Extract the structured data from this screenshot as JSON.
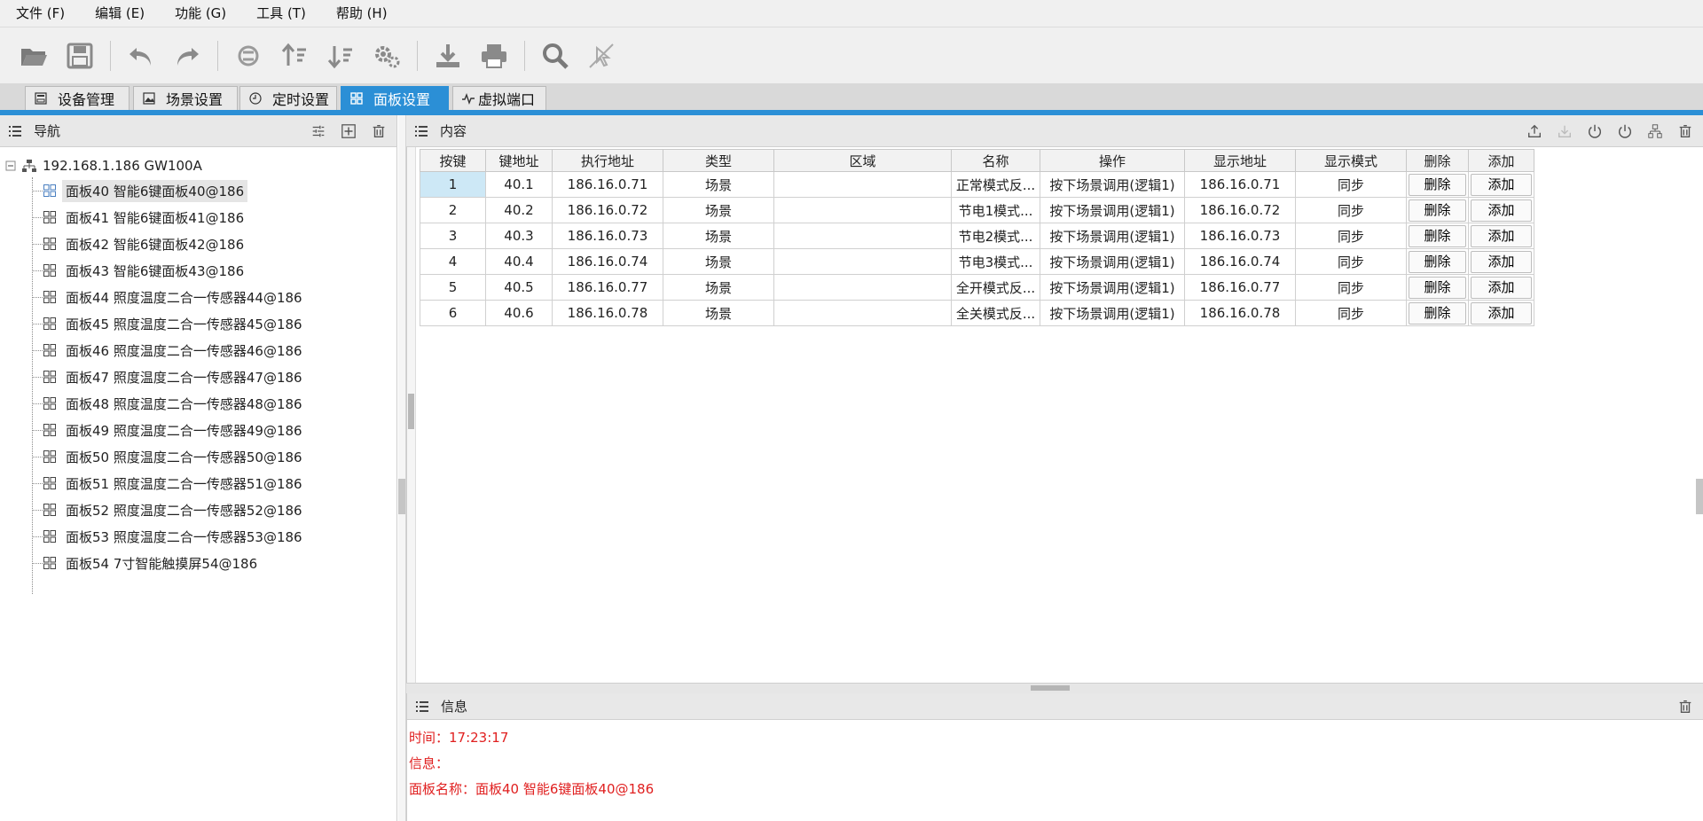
{
  "menu": [
    {
      "label": "文件 (F)"
    },
    {
      "label": "编辑 (E)"
    },
    {
      "label": "功能 (G)"
    },
    {
      "label": "工具 (T)"
    },
    {
      "label": "帮助 (H)"
    }
  ],
  "toolbar": {
    "buttons": [
      "open-folder-icon",
      "save-icon",
      "undo-icon",
      "redo-icon",
      "sync-icon",
      "sort-ascending-icon",
      "sort-descending-icon",
      "settings-icon",
      "download-icon",
      "print-icon",
      "search-icon",
      "disabled-pointer-icon"
    ]
  },
  "tabs": [
    {
      "label": "设备管理",
      "icon": "device-icon",
      "active": false
    },
    {
      "label": "场景设置",
      "icon": "image-icon",
      "active": false
    },
    {
      "label": "定时设置",
      "icon": "clock-icon",
      "active": false
    },
    {
      "label": "面板设置",
      "icon": "panel-grid-icon",
      "active": true
    },
    {
      "label": "虚拟端口",
      "icon": "pulse-icon",
      "active": false
    }
  ],
  "nav": {
    "title": "导航",
    "root": "192.168.1.186 GW100A",
    "items": [
      "面板40 智能6键面板40@186",
      "面板41 智能6键面板41@186",
      "面板42 智能6键面板42@186",
      "面板43 智能6键面板43@186",
      "面板44 照度温度二合一传感器44@186",
      "面板45 照度温度二合一传感器45@186",
      "面板46 照度温度二合一传感器46@186",
      "面板47 照度温度二合一传感器47@186",
      "面板48 照度温度二合一传感器48@186",
      "面板49 照度温度二合一传感器49@186",
      "面板50 照度温度二合一传感器50@186",
      "面板51 照度温度二合一传感器51@186",
      "面板52 照度温度二合一传感器52@186",
      "面板53 照度温度二合一传感器53@186",
      "面板54 7寸智能触摸屏54@186"
    ],
    "selected_index": 0
  },
  "content": {
    "title": "内容",
    "columns": [
      "按键",
      "键地址",
      "执行地址",
      "类型",
      "区域",
      "名称",
      "操作",
      "显示地址",
      "显示模式",
      "删除",
      "添加"
    ],
    "rows": [
      {
        "key": "1",
        "key_addr": "40.1",
        "exec_addr": "186.16.0.71",
        "type": "场景",
        "area": "",
        "name": "正常模式反...",
        "op": "按下场景调用(逻辑1)",
        "disp_addr": "186.16.0.71",
        "disp_mode": "同步",
        "del": "删除",
        "add": "添加"
      },
      {
        "key": "2",
        "key_addr": "40.2",
        "exec_addr": "186.16.0.72",
        "type": "场景",
        "area": "",
        "name": "节电1模式...",
        "op": "按下场景调用(逻辑1)",
        "disp_addr": "186.16.0.72",
        "disp_mode": "同步",
        "del": "删除",
        "add": "添加"
      },
      {
        "key": "3",
        "key_addr": "40.3",
        "exec_addr": "186.16.0.73",
        "type": "场景",
        "area": "",
        "name": "节电2模式...",
        "op": "按下场景调用(逻辑1)",
        "disp_addr": "186.16.0.73",
        "disp_mode": "同步",
        "del": "删除",
        "add": "添加"
      },
      {
        "key": "4",
        "key_addr": "40.4",
        "exec_addr": "186.16.0.74",
        "type": "场景",
        "area": "",
        "name": "节电3模式...",
        "op": "按下场景调用(逻辑1)",
        "disp_addr": "186.16.0.74",
        "disp_mode": "同步",
        "del": "删除",
        "add": "添加"
      },
      {
        "key": "5",
        "key_addr": "40.5",
        "exec_addr": "186.16.0.77",
        "type": "场景",
        "area": "",
        "name": "全开模式反...",
        "op": "按下场景调用(逻辑1)",
        "disp_addr": "186.16.0.77",
        "disp_mode": "同步",
        "del": "删除",
        "add": "添加"
      },
      {
        "key": "6",
        "key_addr": "40.6",
        "exec_addr": "186.16.0.78",
        "type": "场景",
        "area": "",
        "name": "全关模式反...",
        "op": "按下场景调用(逻辑1)",
        "disp_addr": "186.16.0.78",
        "disp_mode": "同步",
        "del": "删除",
        "add": "添加"
      }
    ]
  },
  "info": {
    "title": "信息",
    "lines": [
      "时间：17:23:17",
      "信息：",
      "面板名称：面板40 智能6键面板40@186"
    ]
  },
  "colors": {
    "accent": "#2b8fd6",
    "info_text": "#e02020",
    "selected_cell": "#cde8f6"
  }
}
